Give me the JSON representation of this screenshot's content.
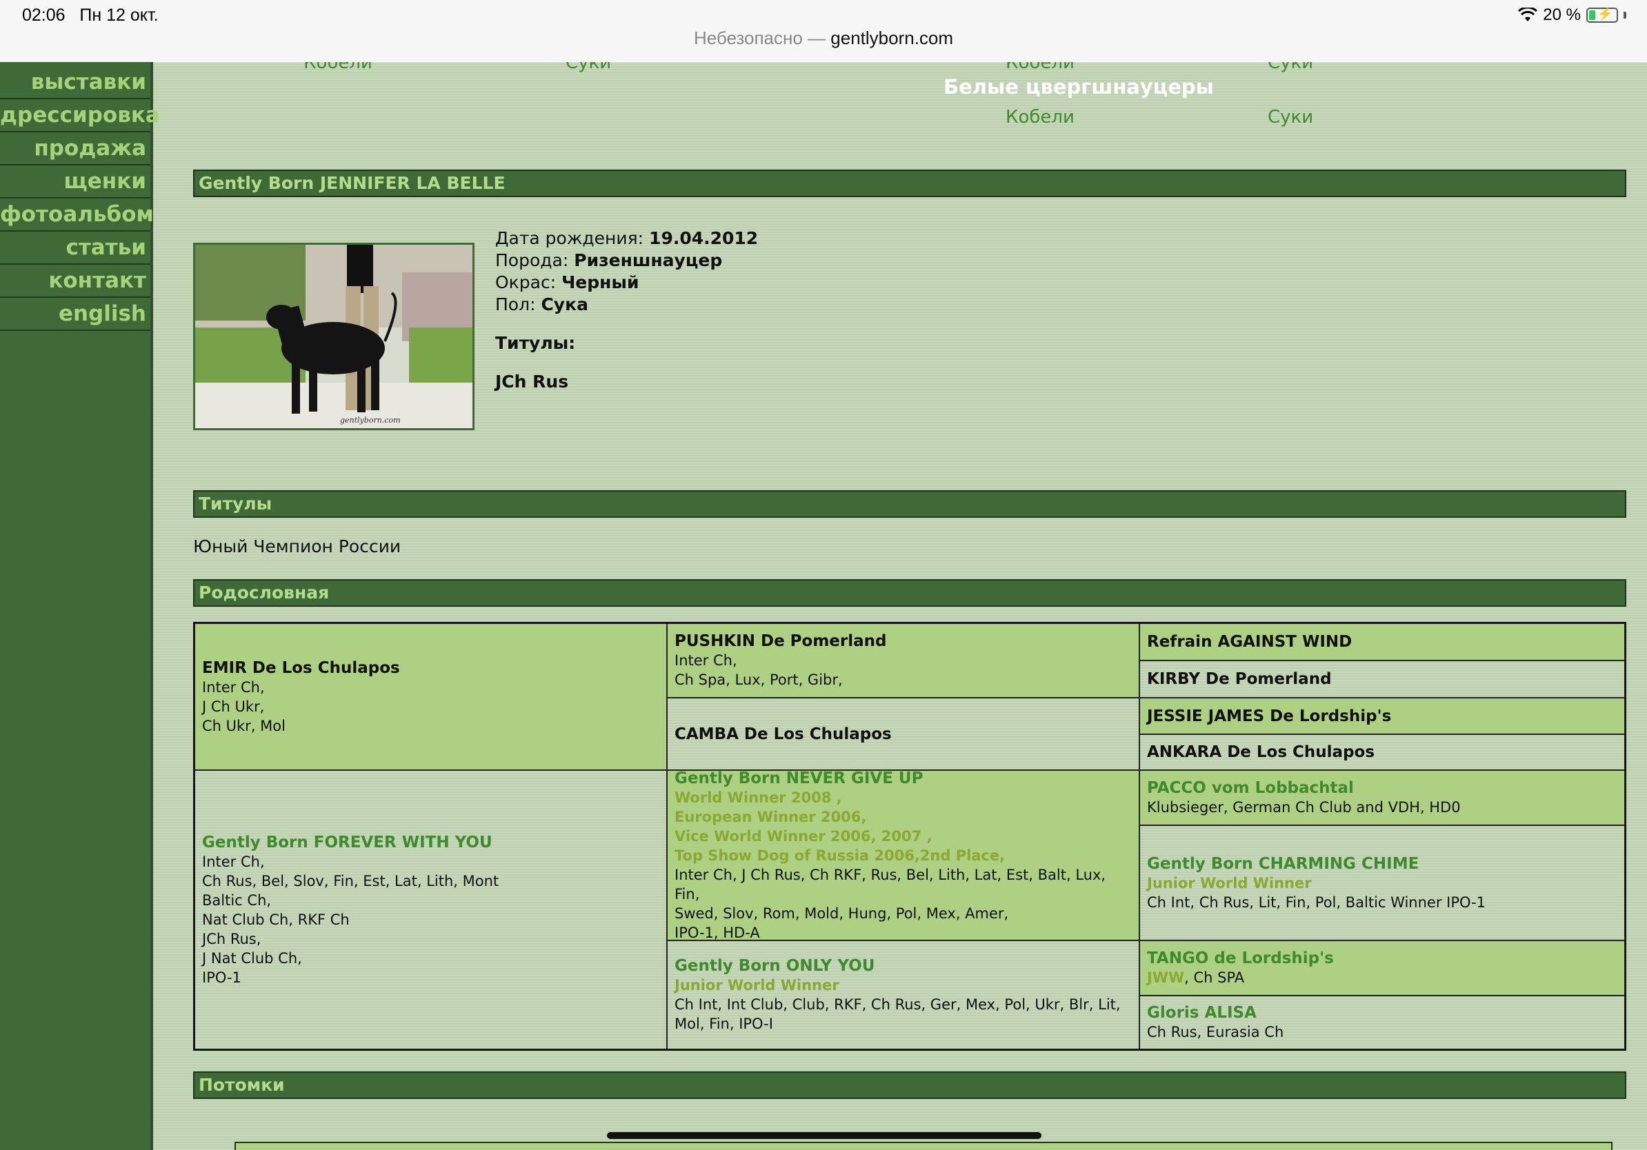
{
  "status_bar": {
    "time": "02:06",
    "date": "Пн 12 окт.",
    "battery": "20 %",
    "icons": [
      "wifi-icon",
      "battery-icon"
    ]
  },
  "address_bar": {
    "prefix": "Небезопасно —",
    "host": "gentlyborn.com"
  },
  "sidebar": {
    "items": [
      {
        "label": "выставки"
      },
      {
        "label": "дрессировка"
      },
      {
        "label": "продажа"
      },
      {
        "label": "щенки"
      },
      {
        "label": "фотоальбом"
      },
      {
        "label": "статьи"
      },
      {
        "label": "контакт"
      },
      {
        "label": "english"
      }
    ]
  },
  "top_links": {
    "row1": [
      "Кобели",
      "Суки",
      "Кобели",
      "Суки"
    ],
    "white_breed_title": "Белые цвергшнауцеры",
    "row2": [
      "Кобели",
      "Суки"
    ]
  },
  "dog": {
    "name_bar": "Gently Born JENNIFER LA BELLE",
    "photo_watermark": "gentlyborn.com",
    "birth_label": "Дата рождения:",
    "birth_value": "19.04.2012",
    "breed_label": "Порода:",
    "breed_value": "Ризеншнауцер",
    "color_label": "Окрас:",
    "color_value": "Черный",
    "sex_label": "Пол:",
    "sex_value": "Сука",
    "titles_label": "Титулы:",
    "titles_value": "JCh Rus"
  },
  "titles_section": {
    "bar": "Титулы",
    "text": "Юный Чемпион России"
  },
  "pedigree": {
    "bar": "Родословная",
    "sire": {
      "name": "EMIR De Los Chulapos",
      "lines": [
        "Inter Ch,",
        "J Ch Ukr,",
        "Ch Ukr, Mol"
      ]
    },
    "sire_sire": {
      "name": "PUSHKIN De Pomerland",
      "lines": [
        "Inter Ch,",
        "Ch Spa, Lux, Port, Gibr,"
      ]
    },
    "sire_dam": {
      "name": "CAMBA De Los Chulapos"
    },
    "g3_1": {
      "name": "Refrain AGAINST WIND"
    },
    "g3_2": {
      "name": "KIRBY De Pomerland"
    },
    "g3_3": {
      "name": "JESSIE JAMES De Lordship's"
    },
    "g3_4": {
      "name": "ANKARA De Los Chulapos"
    },
    "dam": {
      "name": "Gently Born FOREVER WITH YOU",
      "lines": [
        "Inter Ch,",
        "Ch Rus, Bel, Slov, Fin, Est, Lat, Lith, Mont",
        "Baltic Ch,",
        "Nat Club Ch, RKF Ch",
        "JCh Rus,",
        "J Nat Club Ch,",
        "IPO-1"
      ]
    },
    "dam_sire": {
      "name": "Gently Born NEVER GIVE UP",
      "awards": [
        "World Winner 2008 ,",
        "European Winner 2006,",
        "Vice World Winner 2006, 2007 ,",
        "Top Show Dog of Russia 2006,2nd Place,"
      ],
      "lines": [
        "Inter Ch, J Ch Rus, Ch RKF, Rus, Bel, Lith, Lat, Est, Balt, Lux, Fin,",
        "Swed, Slov, Rom, Mold, Hung, Pol, Mex, Amer,",
        "IPO-1, HD-A"
      ]
    },
    "dam_dam": {
      "name": "Gently Born ONLY YOU",
      "awards": [
        "Junior World Winner"
      ],
      "lines": [
        "Ch Int, Int Club, Club, RKF, Ch Rus, Ger, Mex, Pol, Ukr, Blr, Lit,",
        "Mol, Fin, IPO-I"
      ]
    },
    "g3_5": {
      "name": "PACCO vom Lobbachtal",
      "lines": [
        "Klubsieger, German Ch Club and VDH, HD0"
      ]
    },
    "g3_6": {
      "name": "Gently Born CHARMING CHIME",
      "awards": [
        "Junior World Winner"
      ],
      "lines": [
        "Ch Int, Ch Rus, Lit, Fin, Pol, Baltic Winner IPO-1"
      ]
    },
    "g3_7": {
      "name": "TANGO de Lordship's",
      "award_inline": "JWW",
      "rest": ", Ch SPA"
    },
    "g3_8": {
      "name": "Gloris ALISA",
      "lines": [
        "Ch Rus, Eurasia Ch"
      ]
    }
  },
  "offspring": {
    "bar": "Потомки"
  },
  "colors": {
    "sidebar_bg": "#3f6a38",
    "nav_text": "#a5d27a",
    "link_green": "#3e8a2c",
    "pedigree_green": "#aed083",
    "award_olive": "#8aa832"
  }
}
